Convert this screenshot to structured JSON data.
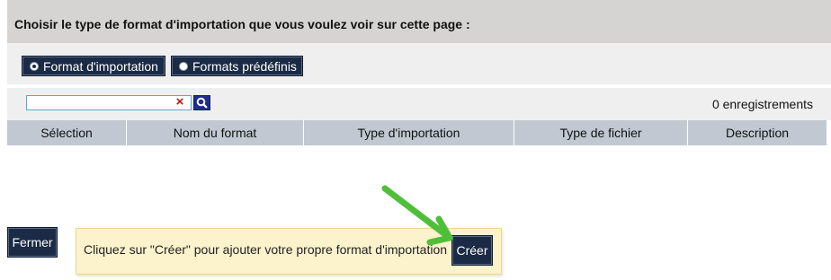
{
  "header": {
    "title": "Choisir le type de format d'importation que vous voulez voir sur cette page :"
  },
  "format_choice": {
    "options": [
      {
        "label": "Format d'importation",
        "selected": true
      },
      {
        "label": "Formats prédéfinis",
        "selected": false
      }
    ]
  },
  "search": {
    "value": "",
    "placeholder": "",
    "clear_icon": "×",
    "record_count": "0 enregistrements"
  },
  "table": {
    "columns": [
      "Sélection",
      "Nom du format",
      "Type d'importation",
      "Type de fichier",
      "Description"
    ],
    "rows": []
  },
  "actions": {
    "close_label": "Fermer",
    "create_label": "Créer"
  },
  "tip": {
    "text": "Cliquez sur \"Créer\" pour ajouter votre propre format d'importation"
  },
  "colors": {
    "button_bg": "#1b2a45",
    "header_bg": "#d6d3d3",
    "table_header_bg": "#c1c8d2",
    "tip_bg": "#fcf2cc",
    "arrow": "#4fbf3a"
  }
}
